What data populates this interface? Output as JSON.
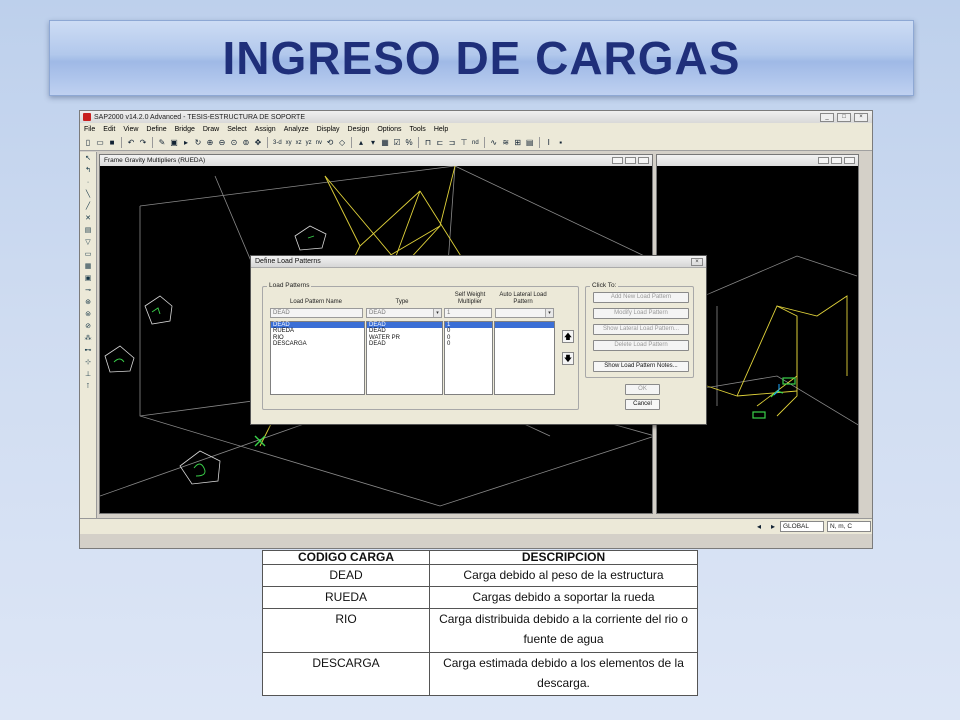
{
  "slide": {
    "title": "INGRESO DE CARGAS"
  },
  "app": {
    "window_title": "SAP2000 v14.2.0 Advanced  - TESIS-ESTRUCTURA DE SOPORTE",
    "menu": [
      "File",
      "Edit",
      "View",
      "Define",
      "Bridge",
      "Draw",
      "Select",
      "Assign",
      "Analyze",
      "Display",
      "Design",
      "Options",
      "Tools",
      "Help"
    ],
    "toolbar_text": {
      "view3d": "3-d",
      "xy": "xy",
      "xz": "xz",
      "yz": "yz",
      "nv": "nv",
      "nd": "nd"
    },
    "left_view_title": "Frame Gravity Multipliers (RUEDA)",
    "status": {
      "coord_system": "GLOBAL",
      "units": "N, m, C"
    }
  },
  "dialog": {
    "title": "Define Load Patterns",
    "group_load_patterns": "Load Patterns",
    "group_click_to": "Click To:",
    "columns": {
      "name": "Load Pattern Name",
      "type": "Type",
      "self_weight": "Self Weight Multiplier",
      "auto_lateral": "Auto Lateral Load Pattern"
    },
    "inputs": {
      "name": "DEAD",
      "type": "DEAD",
      "self_weight": "1"
    },
    "rows": [
      {
        "name": "DEAD",
        "type": "DEAD",
        "multiplier": "1",
        "selected": true
      },
      {
        "name": "RUEDA",
        "type": "DEAD",
        "multiplier": "0",
        "selected": false
      },
      {
        "name": "RIO",
        "type": "WATER PR",
        "multiplier": "0",
        "selected": false
      },
      {
        "name": "DESCARGA",
        "type": "DEAD",
        "multiplier": "0",
        "selected": false
      }
    ],
    "buttons": {
      "add": "Add New Load Pattern",
      "modify": "Modify Load Pattern",
      "show_lateral": "Show Lateral Load Pattern...",
      "delete": "Delete Load Pattern",
      "notes": "Show Load Pattern Notes...",
      "ok": "OK",
      "cancel": "Cancel"
    }
  },
  "table": {
    "headers": [
      "CODIGO CARGA",
      "DESCRIPCION"
    ],
    "rows": [
      [
        "DEAD",
        "Carga debido al peso de la estructura"
      ],
      [
        "RUEDA",
        "Cargas debido a soportar la rueda"
      ],
      [
        "RIO",
        "Carga distribuida debido a la corriente del rio o fuente de agua"
      ],
      [
        "DESCARGA",
        "Carga estimada debido a los elementos de la descarga."
      ]
    ]
  },
  "colors": {
    "title_text": "#1f2f7a",
    "viewport_bg": "#000000",
    "selection": "#3b6fd6",
    "model_lines": "#e0d23a"
  }
}
